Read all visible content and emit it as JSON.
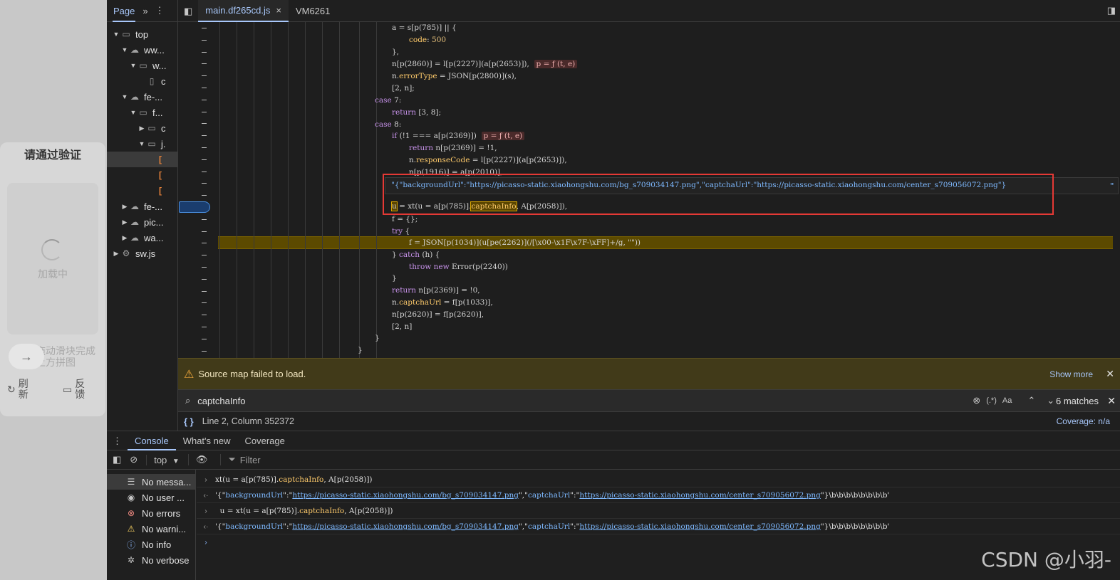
{
  "page_overlay": {
    "title": "请通过验证",
    "loading": "加载中",
    "slider_hint": "拖动滑块完成上方拼图",
    "refresh": "刷新",
    "feedback": "反馈"
  },
  "navigator": {
    "tab": "Page",
    "items": [
      {
        "label": "top",
        "icon": "frame-icon",
        "level": 0,
        "expanded": true
      },
      {
        "label": "ww...",
        "icon": "cloud-icon",
        "level": 1,
        "expanded": true
      },
      {
        "label": "w...",
        "icon": "folder-icon",
        "level": 2,
        "expanded": true
      },
      {
        "label": "c",
        "icon": "file-icon",
        "level": 3
      },
      {
        "label": "fe-...",
        "icon": "cloud-icon",
        "level": 1,
        "expanded": true
      },
      {
        "label": "f...",
        "icon": "folder-icon",
        "level": 2,
        "expanded": true
      },
      {
        "label": "c",
        "icon": "folder-icon",
        "level": 3,
        "expanded": false
      },
      {
        "label": "j.",
        "icon": "folder-icon",
        "level": 3,
        "expanded": true
      },
      {
        "label": "",
        "icon": "script-file-icon",
        "level": 4
      },
      {
        "label": "",
        "icon": "script-file-icon",
        "level": 4
      },
      {
        "label": "",
        "icon": "script-file-icon",
        "level": 4
      },
      {
        "label": "fe-...",
        "icon": "cloud-icon",
        "level": 1,
        "expanded": false
      },
      {
        "label": "pic...",
        "icon": "cloud-icon",
        "level": 1,
        "expanded": false
      },
      {
        "label": "wa...",
        "icon": "cloud-icon",
        "level": 1,
        "expanded": false
      },
      {
        "label": "sw.js",
        "icon": "gear-icon",
        "level": 0,
        "expanded": false
      }
    ]
  },
  "editor": {
    "tabs": [
      {
        "label": "main.df265cd.js",
        "active": true
      },
      {
        "label": "VM6261",
        "active": false
      }
    ],
    "tooltip": "\"{\"backgroundUrl\":\"https://picasso-static.xiaohongshu.com/bg_s709034147.png\",\"captchaUrl\":\"https://picasso-static.xiaohongshu.com/center_s709056072.png\"}",
    "tooltip_end": "\""
  },
  "warning": {
    "text": "Source map failed to load.",
    "action": "Show more"
  },
  "search": {
    "value": "captchaInfo",
    "regex": "(.*)",
    "case": "Aa",
    "matches": "6 matches"
  },
  "status": {
    "position": "Line 2, Column 352372",
    "coverage": "Coverage: n/a"
  },
  "drawer": {
    "tabs": [
      "Console",
      "What's new",
      "Coverage"
    ],
    "context": "top",
    "filter_placeholder": "Filter",
    "sidebar": [
      {
        "label": "No messa...",
        "icon": "list-icon"
      },
      {
        "label": "No user ...",
        "icon": "user-icon"
      },
      {
        "label": "No errors",
        "icon": "error-icon"
      },
      {
        "label": "No warni...",
        "icon": "warning-icon"
      },
      {
        "label": "No info",
        "icon": "info-icon"
      },
      {
        "label": "No verbose",
        "icon": "bug-icon"
      }
    ],
    "console_lines": [
      {
        "kind": "input",
        "text": "xt(u = a[p(785)].captchaInfo, A[p(2058)])"
      },
      {
        "kind": "result",
        "text": "'{\"backgroundUrl\":\"https://picasso-static.xiaohongshu.com/bg_s709034147.png\",\"captchaUrl\":\"https://picasso-static.xiaohongshu.com/center_s709056072.png\"}\\b\\b\\b\\b\\b\\b\\b\\b'"
      },
      {
        "kind": "input",
        "text": "  u = xt(u = a[p(785)].captchaInfo, A[p(2058)])"
      },
      {
        "kind": "result",
        "text": "'{\"backgroundUrl\":\"https://picasso-static.xiaohongshu.com/bg_s709034147.png\",\"captchaUrl\":\"https://picasso-static.xiaohongshu.com/center_s709056072.png\"}\\b\\b\\b\\b\\b\\b\\b\\b'"
      }
    ]
  },
  "watermark": "CSDN @小羽-"
}
